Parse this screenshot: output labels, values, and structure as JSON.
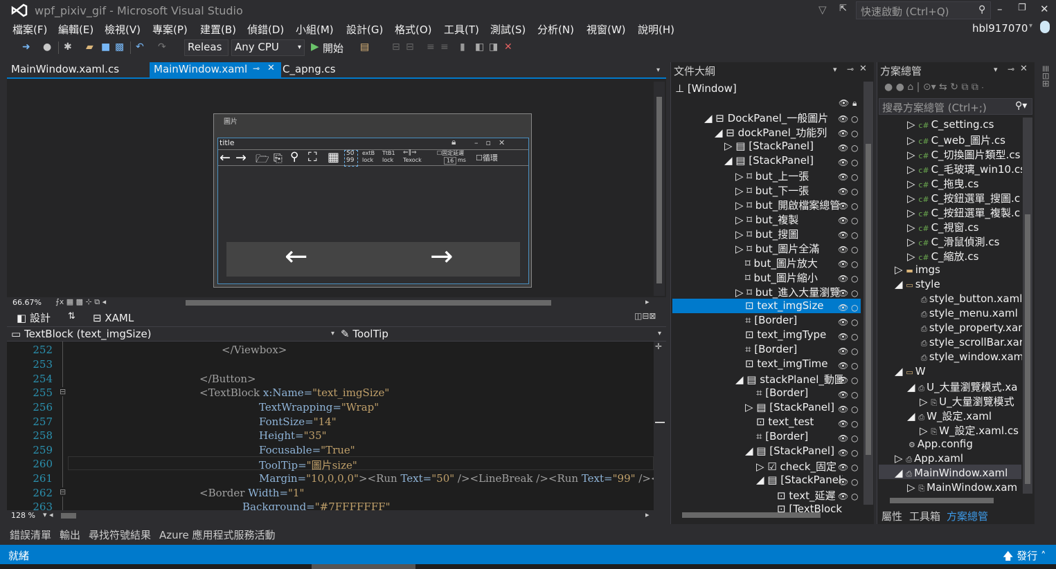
{
  "window": {
    "title": "wpf_pixiv_gif - Microsoft Visual Studio",
    "quick_launch": "快速啟動 (Ctrl+Q)",
    "user": "hbl917070"
  },
  "menu": [
    "檔案(F)",
    "編輯(E)",
    "檢視(V)",
    "專案(P)",
    "建置(B)",
    "偵錯(D)",
    "小組(M)",
    "設計(G)",
    "格式(O)",
    "工具(T)",
    "測試(S)",
    "分析(N)",
    "視窗(W)",
    "說明(H)"
  ],
  "toolbar": {
    "config": "Releas",
    "platform": "Any CPU",
    "start": "開始"
  },
  "tabs": [
    {
      "label": "MainWindow.xaml.cs"
    },
    {
      "label": "MainWindow.xaml",
      "active": true
    },
    {
      "label": "C_apng.cs"
    }
  ],
  "designer": {
    "window_caption": "圖片",
    "title": "title",
    "lock1": "lock",
    "lock2": "lock",
    "texlock": "Texock",
    "extb": "extB",
    "tb1": "TtB1",
    "fixed_delay": "固定延遲",
    "delay_val": "16",
    "ms": "ms",
    "loop": "循環",
    "num1": "50",
    "num2": "99",
    "zoom": "66.67%"
  },
  "view_tabs": {
    "design": "設計",
    "xaml": "XAML"
  },
  "nav_bar": {
    "left": "TextBlock (text_imgSize)",
    "right": "ToolTip"
  },
  "code": {
    "lines": [
      "252",
      "253",
      "254",
      "255",
      "256",
      "257",
      "258",
      "259",
      "260",
      "261",
      "262",
      "263"
    ],
    "l252": "</Viewbox>",
    "l254": "</Button>",
    "l255a": "<TextBlock ",
    "l255b": "x:Name=",
    "l255c": "\"text_imgSize\"",
    "l256a": "TextWrapping=",
    "l256b": "\"Wrap\"",
    "l257a": "FontSize=",
    "l257b": "\"14\"",
    "l258a": "Height=",
    "l258b": "\"35\"",
    "l259a": "Focusable=",
    "l259b": "\"True\"",
    "l260a": "ToolTip=",
    "l260b": "\"圖片size\"",
    "l261a": "Margin=",
    "l261b": "\"10,0,0,0\"",
    "l261c": "><Run ",
    "l261d": "Text=",
    "l261e": "\"50\"",
    "l261f": " /><LineBreak /><Run ",
    "l261g": "Text=",
    "l261h": "\"99\"",
    "l261i": " /></TextB",
    "l262a": "<Border ",
    "l262b": "Width=",
    "l262c": "\"1\"",
    "l263a": "Background=",
    "l263b": "\"#7FFFFFFF\"",
    "zoom": "128 %"
  },
  "outline": {
    "title": "文件大綱",
    "root": "[Window]",
    "items": [
      "DockPanel_一般圖片",
      "dockPanel_功能列",
      "[StackPanel]",
      "[StackPanel]",
      "but_上一張",
      "but_下一張",
      "but_開啟檔案總管",
      "but_複製",
      "but_搜圖",
      "but_圖片全滿",
      "but_圖片放大",
      "but_圖片縮小",
      "but_進入大量瀏覽",
      "text_imgSize",
      "[Border]",
      "text_imgType",
      "[Border]",
      "text_imgTime",
      "stackPlanel_動圖",
      "[Border]",
      "[StackPanel]",
      "text_test",
      "[Border]",
      "[StackPanel]",
      "check_固定",
      "[StackPanel]",
      "text_延遲",
      "[TextBlock"
    ]
  },
  "solution": {
    "title": "方案總管",
    "search": "搜尋方案總管 (Ctrl+;)",
    "items": [
      "C_setting.cs",
      "C_web_圖片.cs",
      "C_切換圖片類型.cs",
      "C_毛玻璃_win10.cs",
      "C_拖曳.cs",
      "C_按鈕選單_搜圖.c",
      "C_按鈕選單_複製.c",
      "C_視窗.cs",
      "C_滑鼠偵測.cs",
      "C_縮放.cs",
      "imgs",
      "style",
      "style_button.xaml",
      "style_menu.xaml",
      "style_property.xar",
      "style_scrollBar.xar",
      "style_window.xam",
      "W",
      "U_大量瀏覽模式.xa",
      "U_大量瀏覽模式",
      "W_設定.xaml",
      "W_設定.xaml.cs",
      "App.config",
      "App.xaml",
      "MainWindow.xaml",
      "MainWindow.xam"
    ],
    "bottom_tabs": [
      "屬性",
      "工具箱",
      "方案總管"
    ]
  },
  "bottom_tabs": [
    "錯誤清單",
    "輸出",
    "尋找符號結果",
    "Azure 應用程式服務活動"
  ],
  "status": {
    "text": "就緒",
    "publish": "發行"
  }
}
